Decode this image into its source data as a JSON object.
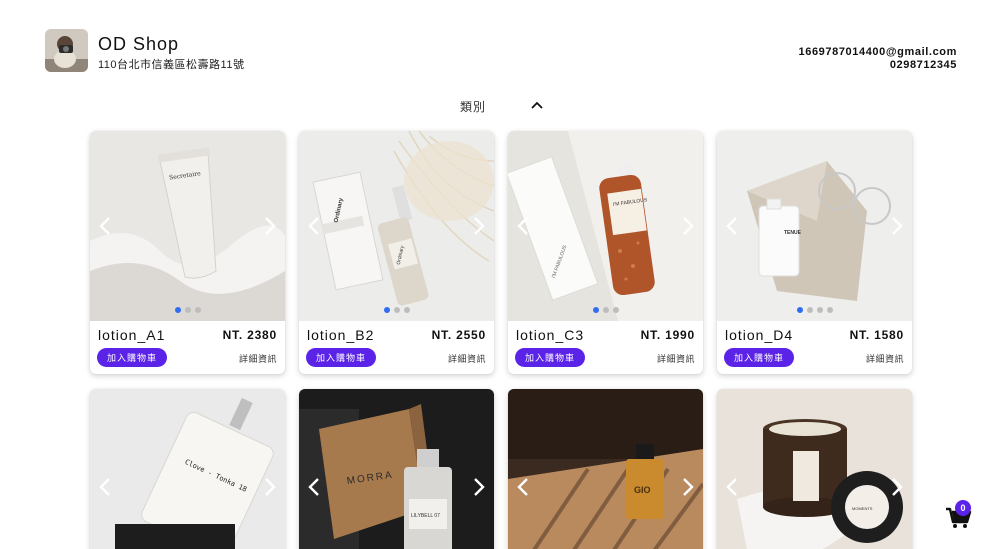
{
  "header": {
    "shop_name": "OD Shop",
    "address": "110台北市信義區松壽路11號",
    "email": "1669787014400@gmail.com",
    "phone": "0298712345"
  },
  "category": {
    "label": "類別"
  },
  "colors": {
    "accent": "#5b22e8",
    "dot_active": "#2f6df2"
  },
  "products": [
    {
      "name": "lotion_A1",
      "price": "NT. 2380",
      "add_label": "加入購物車",
      "details_label": "詳細資訊"
    },
    {
      "name": "lotion_B2",
      "price": "NT. 2550",
      "add_label": "加入購物車",
      "details_label": "詳細資訊"
    },
    {
      "name": "lotion_C3",
      "price": "NT. 1990",
      "add_label": "加入購物車",
      "details_label": "詳細資訊"
    },
    {
      "name": "lotion_D4",
      "price": "NT. 1580",
      "add_label": "加入購物車",
      "details_label": "詳細資訊"
    }
  ],
  "bottle_labels": {
    "a1": "Secretaire",
    "b2": "Ordinary",
    "c3": "I'M FABULOUS",
    "d4": "TENUE",
    "p1": "Clove - Tonka 18",
    "p2_box": "MORRA",
    "p2_bottle": "LILYBELL 07",
    "p3": "GIO",
    "p4": "MOMENTS"
  },
  "cart": {
    "count": "0",
    "icon": "cart-icon"
  }
}
